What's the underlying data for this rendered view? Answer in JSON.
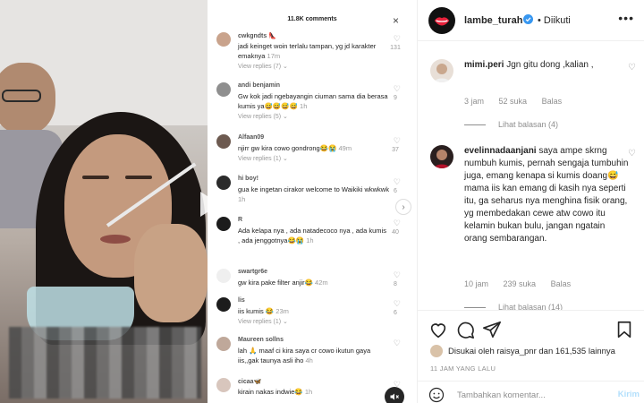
{
  "tiktok": {
    "comment_count": "11.8K comments",
    "close": "×",
    "comments": [
      {
        "name": "cwkgndts 👠",
        "text": "jadi keinget woin terlalu tampan, yg jd karakter emaknya",
        "time": "17m",
        "replies": "View replies (7) ⌄",
        "likes": "131",
        "color": "#c9a38c"
      },
      {
        "name": "andi benjamin",
        "text": "Gw kok jadi ngebayangin ciuman sama dia berasa kumis ya😅😅😅😅",
        "time": "1h",
        "replies": "View replies (5) ⌄",
        "likes": "9",
        "color": "#8f8f8f"
      },
      {
        "name": "Alfaan09",
        "text": "njirr gw kira cowo gondrong😂😭",
        "time": "49m",
        "replies": "View replies (1) ⌄",
        "likes": "37",
        "color": "#6d5a50"
      },
      {
        "name": "hi boy!",
        "text": "gua ke ingetan cirakor welcome to Waikiki wkwkwk",
        "time": "1h",
        "replies": "",
        "likes": "6",
        "color": "#2b2b2b"
      },
      {
        "name": "R",
        "text": "Ada kelapa nya , ada natadecoco nya , ada kumis , ada jenggotnya😂😭",
        "time": "1h",
        "replies": "",
        "likes": "40",
        "color": "#1c1c1c"
      },
      {
        "name": "swartgr6e",
        "text": "gw kira pake filter anjir😂",
        "time": "42m",
        "replies": "",
        "likes": "8",
        "color": "#efefef"
      },
      {
        "name": "lis",
        "text": "iis kumis 😂",
        "time": "23m",
        "replies": "View replies (1) ⌄",
        "likes": "6",
        "color": "#1c1c1c"
      },
      {
        "name": "Maureen sollns",
        "text": "lah 🙏 maaf ci kira saya cr cowo ikutun gaya iis,,gak taunya asli iho",
        "time": "4h",
        "replies": "",
        "likes": "",
        "color": "#bfa89a"
      },
      {
        "name": "cicaa🦋",
        "text": "kirain nakas indwie😂",
        "time": "1h",
        "replies": "",
        "likes": "",
        "color": "#d8c6bd"
      }
    ]
  },
  "post": {
    "username": "lambe_turah",
    "separator": "•",
    "follow_status": "Diikuti",
    "more": "•••",
    "comments": [
      {
        "username": "mimi.peri",
        "text": "Jgn gitu dong ,kalian ,",
        "time": "3 jam",
        "likes": "52 suka",
        "reply": "Balas",
        "view_replies": "Lihat balasan (4)"
      },
      {
        "username": "evelinnadaanjani",
        "text": "saya ampe skrng numbuh kumis, pernah sengaja tumbuhin juga, emang kenapa si kumis doang😅 mama iis kan emang di kasih nya seperti itu, ga seharus nya menghina fisik orang, yg membedakan cewe atw cowo itu kelamin bukan bulu, jangan ngatain orang sembarangan.",
        "time": "10 jam",
        "likes": "239 suka",
        "reply": "Balas",
        "view_replies": "Lihat balasan (14)"
      }
    ],
    "liked_by": "Disukai oleh raisya_pnr dan 161,535 lainnya",
    "time_ago": "11 JAM YANG LALU",
    "comment_placeholder": "Tambahkan komentar...",
    "post_button": "Kirim"
  },
  "colors": {
    "verified": "#3897f0",
    "logo_lips": "#e8213b",
    "post_button_disabled": "#b2dffc"
  }
}
